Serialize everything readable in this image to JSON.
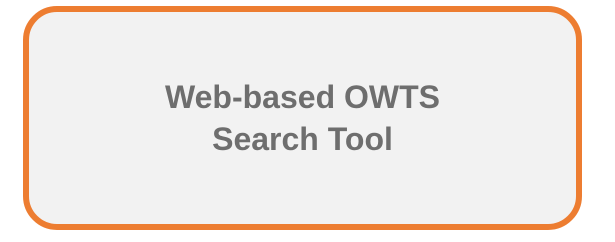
{
  "box": {
    "lines": [
      "Web-based OWTS",
      "Search Tool"
    ],
    "border_color": "#ed7d31",
    "fill_color": "#f2f2f2",
    "text_color": "#6e6e6e"
  }
}
